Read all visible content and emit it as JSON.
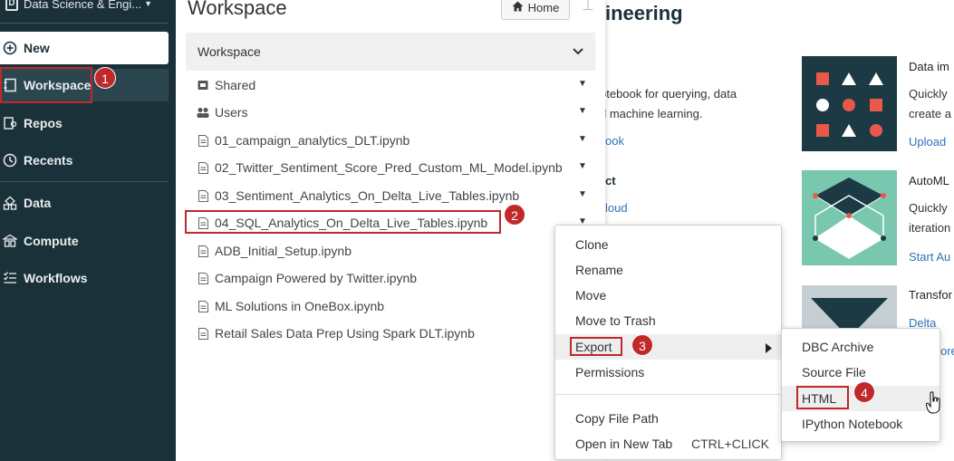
{
  "sidebar": {
    "workspace_name": "Data Science & Engi...",
    "items": [
      {
        "label": "New",
        "icon": "plus-circle-icon"
      },
      {
        "label": "Workspace",
        "icon": "notebook-icon"
      },
      {
        "label": "Repos",
        "icon": "repo-icon"
      },
      {
        "label": "Recents",
        "icon": "clock-icon"
      },
      {
        "label": "Data",
        "icon": "data-icon"
      },
      {
        "label": "Compute",
        "icon": "compute-icon"
      },
      {
        "label": "Workflows",
        "icon": "workflows-icon"
      }
    ]
  },
  "annotations": {
    "b1": "1",
    "b2": "2",
    "b3": "3",
    "b4": "4"
  },
  "panel": {
    "title": "Workspace",
    "home_label": "Home",
    "header_label": "Workspace",
    "rows": [
      {
        "label": "Shared",
        "icon": "shared-folder-icon",
        "caret": true
      },
      {
        "label": "Users",
        "icon": "users-icon",
        "caret": true
      },
      {
        "label": "01_campaign_analytics_DLT.ipynb",
        "icon": "file-icon",
        "caret": true
      },
      {
        "label": "02_Twitter_Sentiment_Score_Pred_Custom_ML_Model.ipynb",
        "icon": "file-icon",
        "caret": true
      },
      {
        "label": "03_Sentiment_Analytics_On_Delta_Live_Tables.ipynb",
        "icon": "file-icon",
        "caret": true
      },
      {
        "label": "04_SQL_Analytics_On_Delta_Live_Tables.ipynb",
        "icon": "file-icon",
        "caret": true
      },
      {
        "label": "ADB_Initial_Setup.ipynb",
        "icon": "file-icon",
        "caret": false
      },
      {
        "label": "Campaign Powered by Twitter.ipynb",
        "icon": "file-icon",
        "caret": false
      },
      {
        "label": "ML Solutions in OneBox.ipynb",
        "icon": "file-icon",
        "caret": false
      },
      {
        "label": "Retail Sales Data Prep Using Spark DLT.ipynb",
        "icon": "file-icon",
        "caret": false
      }
    ]
  },
  "context_menu": {
    "items": [
      "Clone",
      "Rename",
      "Move",
      "Move to Trash",
      "Export",
      "Permissions",
      "Copy File Path",
      "Open in New Tab"
    ],
    "shortcut": "CTRL+CLICK"
  },
  "export_menu": {
    "items": [
      "DBC Archive",
      "Source File",
      "HTML",
      "IPython Notebook"
    ]
  },
  "background": {
    "title_fragment": "ineering",
    "text1": "otebook for querying, data",
    "text2": "d machine learning.",
    "link1": "ook",
    "bold1": "ct",
    "link2": "loud",
    "card1_title": "Data im",
    "card1_text1": "Quickly",
    "card1_text2": "create a",
    "card1_link": "Upload",
    "card2_title": "AutoML",
    "card2_text1": "Quickly",
    "card2_text2": "iteration",
    "card2_link": "Start Au",
    "card3_title": "Transfor",
    "card3_link": "Delta Liv",
    "card3_link2": "ore"
  },
  "colors": {
    "sidebar_bg": "#1b3139",
    "annotation_red": "#c0282a",
    "link_blue": "#2d72b8",
    "tile_dark": "#1b3a44",
    "tile_green": "#78c7ae"
  }
}
